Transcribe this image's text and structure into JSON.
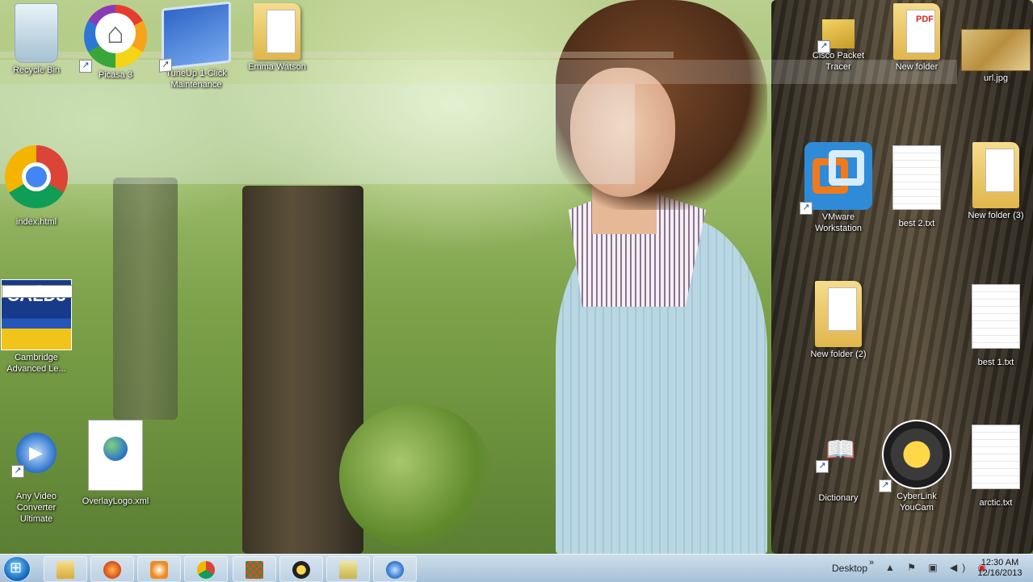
{
  "desktop": {
    "icons": [
      {
        "label": "Recycle Bin"
      },
      {
        "label": "Picasa 3"
      },
      {
        "label": "TuneUp 1-Click Maintenance"
      },
      {
        "label": "Emma Watson"
      },
      {
        "label": "Cisco Packet Tracer"
      },
      {
        "label": "New folder"
      },
      {
        "label": "url.jpg"
      },
      {
        "label": "index.html"
      },
      {
        "label": "VMware Workstation"
      },
      {
        "label": "best 2.txt"
      },
      {
        "label": "New folder (3)"
      },
      {
        "label": "Cambridge Advanced Le..."
      },
      {
        "label": "New folder (2)"
      },
      {
        "label": "best 1.txt"
      },
      {
        "label": "Any Video Converter Ultimate"
      },
      {
        "label": "OverlayLogo.xml"
      },
      {
        "label": "Dictionary"
      },
      {
        "label": "CyberLink YouCam"
      },
      {
        "label": "arctic.txt"
      }
    ],
    "cald_badge": "CALD3",
    "pdf_badge": "PDF"
  },
  "taskbar": {
    "pinned": [
      {
        "icon": "windows-explorer-icon"
      },
      {
        "icon": "firefox-icon"
      },
      {
        "icon": "media-player-icon"
      },
      {
        "icon": "chrome-icon"
      },
      {
        "icon": "app-grid-icon"
      },
      {
        "icon": "webcam-icon"
      },
      {
        "icon": "folder-icon"
      },
      {
        "icon": "video-converter-icon"
      }
    ],
    "tray": {
      "desktop_label": "Desktop",
      "chevron": "»",
      "up_arrow": "▲",
      "time": "12:30 AM",
      "date": "12/16/2013"
    }
  }
}
